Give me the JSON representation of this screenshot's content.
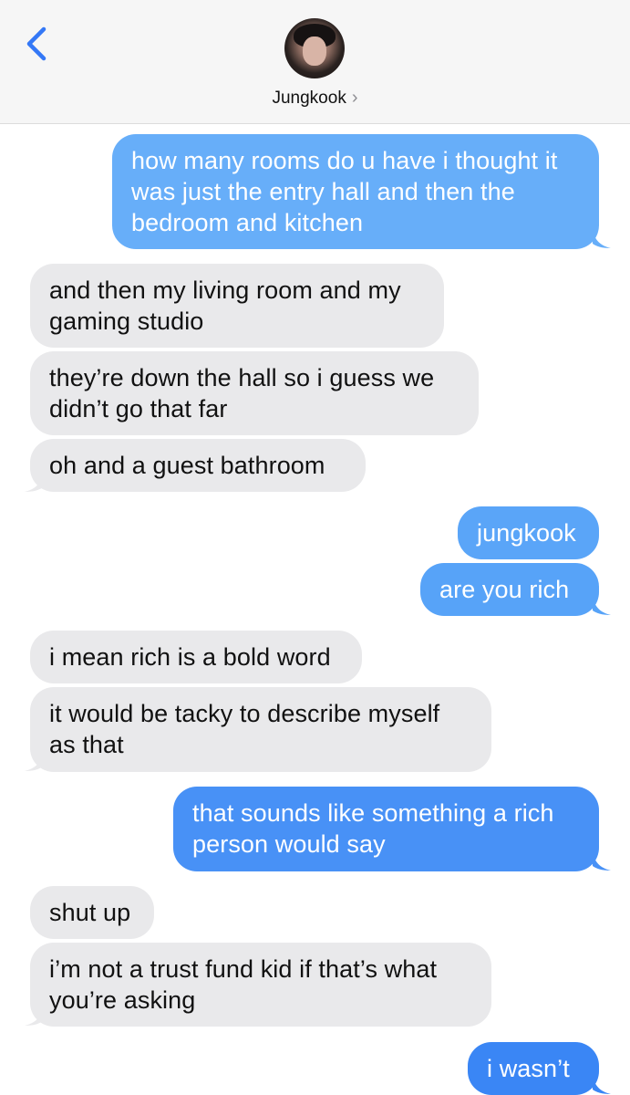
{
  "header": {
    "contact_name": "Jungkook",
    "chevron": "›",
    "back_icon": "chevron-left-icon",
    "accent": "#3478f6"
  },
  "colors": {
    "outgoing_top": "#69b1fa",
    "outgoing_bottom": "#3a86f5",
    "incoming": "#e9e9eb"
  },
  "messages": [
    {
      "from": "me",
      "text": "how many rooms do u have i thought it\nwas just the entry hall and then the\nbedroom and kitchen"
    },
    {
      "from": "them",
      "text": "and then my living room and my\ngaming studio"
    },
    {
      "from": "them",
      "text": "they’re down the hall so i guess we\ndidn’t go that far"
    },
    {
      "from": "them",
      "text": "oh and a guest bathroom"
    },
    {
      "from": "me",
      "text": "jungkook"
    },
    {
      "from": "me",
      "text": "are you rich"
    },
    {
      "from": "them",
      "text": "i mean rich is a bold word"
    },
    {
      "from": "them",
      "text": "it would be tacky to describe myself\nas that"
    },
    {
      "from": "me",
      "text": "that sounds like something a rich\nperson would say"
    },
    {
      "from": "them",
      "text": "shut up"
    },
    {
      "from": "them",
      "text": "i’m not a trust fund kid if that’s what\nyou’re asking"
    },
    {
      "from": "me",
      "text": "i wasn’t"
    }
  ]
}
